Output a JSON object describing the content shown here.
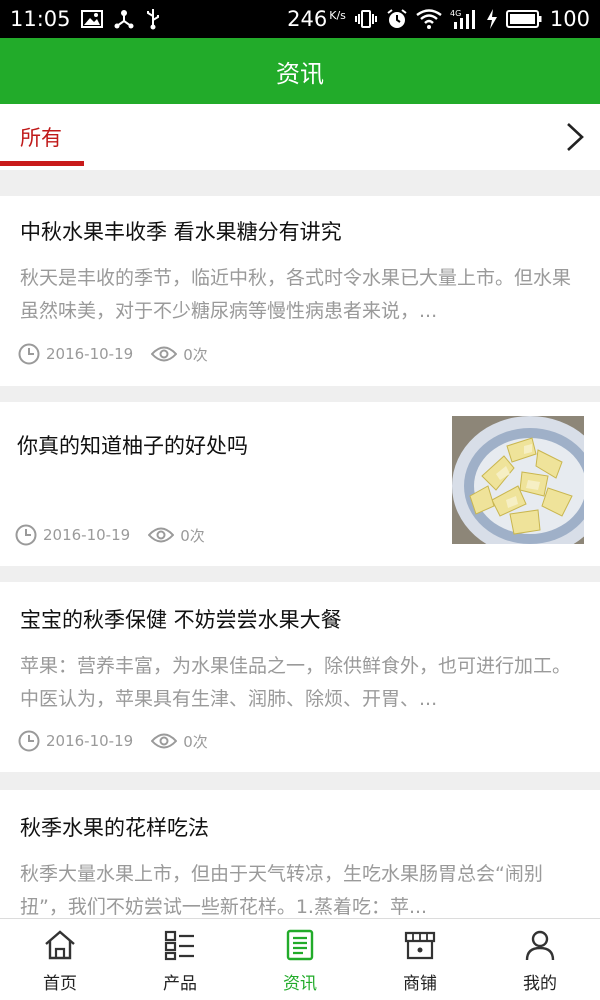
{
  "status_bar": {
    "time": "11:05",
    "speed": "246",
    "speed_unit": "K/s",
    "battery": "100",
    "icons": [
      "image-icon",
      "usb-tree-icon",
      "usb-icon",
      "vibrate-icon",
      "alarm-icon",
      "wifi-icon",
      "4g-signal-icon",
      "charging-icon",
      "battery-icon"
    ]
  },
  "header": {
    "title": "资讯"
  },
  "tabs": {
    "active_label": "所有"
  },
  "articles": [
    {
      "title": "中秋水果丰收季 看水果糖分有讲究",
      "summary": "秋天是丰收的季节，临近中秋，各式时令水果已大量上市。但水果虽然味美，对于不少糖尿病等慢性病患者来说，...",
      "date": "2016-10-19",
      "views": "0次"
    },
    {
      "title": "你真的知道柚子的好处吗",
      "date": "2016-10-19",
      "views": "0次",
      "image": "pomelo-plate-image"
    },
    {
      "title": "宝宝的秋季保健 不妨尝尝水果大餐",
      "summary": "苹果：营养丰富，为水果佳品之一，除供鲜食外，也可进行加工。中医认为，苹果具有生津、润肺、除烦、开胃、...",
      "date": "2016-10-19",
      "views": "0次"
    },
    {
      "title": "秋季水果的花样吃法",
      "summary": "秋季大量水果上市，但由于天气转凉，生吃水果肠胃总会“闹别扭”，我们不妨尝试一些新花样。1.蒸着吃：苹..."
    }
  ],
  "bottom_nav": [
    {
      "label": "首页",
      "icon": "home-icon"
    },
    {
      "label": "产品",
      "icon": "product-list-icon"
    },
    {
      "label": "资讯",
      "icon": "news-icon",
      "active": true
    },
    {
      "label": "商铺",
      "icon": "shop-icon"
    },
    {
      "label": "我的",
      "icon": "user-icon"
    }
  ],
  "colors": {
    "brand_green": "#22ab2a",
    "tab_red": "#c81a1a",
    "muted_text": "#9a9a9a"
  }
}
